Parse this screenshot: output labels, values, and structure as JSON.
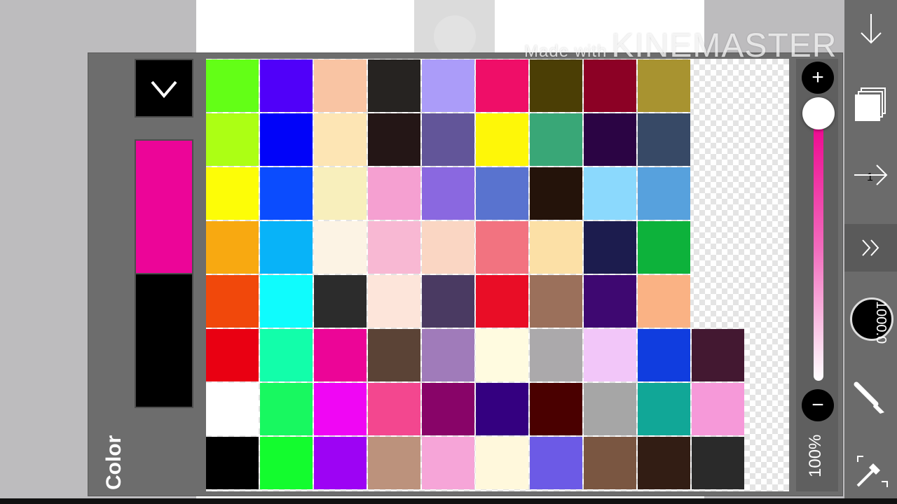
{
  "panel": {
    "label": "Color",
    "opacity_label": "100%",
    "foreground_color": "#ec0598",
    "background_color": "#000000",
    "plus_label": "+",
    "minus_label": "−",
    "opacity_value": 1.0
  },
  "toolbar": {
    "layer_count": "1",
    "brush_size": "1000.0"
  },
  "watermark": {
    "prefix": "Made with",
    "brand": "KINEMASTER"
  },
  "palette": {
    "rows": [
      [
        "#63ff16",
        "#5000f9",
        "#f9c4a3",
        "#262321",
        "#ab9cf9",
        "#ef0e68",
        "#4b3e05",
        "#8c0125",
        "#a89330"
      ],
      [
        "#acff14",
        "#0103f9",
        "#fde5b4",
        "#241616",
        "#625599",
        "#fef708",
        "#39a777",
        "#2b0444",
        "#374966"
      ],
      [
        "#fdfd07",
        "#0b4cfe",
        "#f8efbc",
        "#f5a0d1",
        "#8a68e0",
        "#5973cf",
        "#24130a",
        "#8bd9fd",
        "#57a1dd"
      ],
      [
        "#f8a911",
        "#08b3f8",
        "#fcf3e4",
        "#f8b8d3",
        "#fad6c3",
        "#f27380",
        "#fce0a6",
        "#1c1c4e",
        "#0db23b"
      ],
      [
        "#f1480b",
        "#0ffcfd",
        "#2c2c2c",
        "#fde5da",
        "#4a3a62",
        "#e90d26",
        "#9b705b",
        "#3e0871",
        "#fab284"
      ],
      [
        "#e90012",
        "#12feaa",
        "#ec0597",
        "#5b4336",
        "#a07bba",
        "#fffbe0",
        "#aba9ab",
        "#f2c6f9",
        "#103ddf",
        "#431831"
      ],
      [
        "#ffffff",
        "#18f860",
        "#f006f4",
        "#f3478f",
        "#880468",
        "#340080",
        "#4a0000",
        "#a6a6a6",
        "#11a797",
        "#f699d9"
      ],
      [
        "#000000",
        "#13fc2e",
        "#9d03f4",
        "#bc927c",
        "#f6a5d8",
        "#fff8dc",
        "#6c5ae6",
        "#7a5641",
        "#321d14",
        "#2a2a2a"
      ]
    ]
  }
}
